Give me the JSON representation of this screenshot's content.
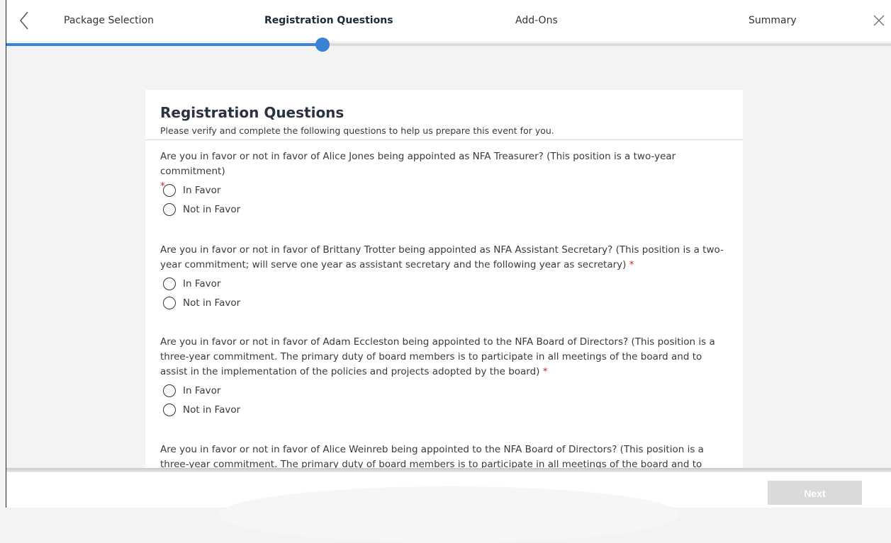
{
  "wizard": {
    "steps": [
      {
        "label": "Package Selection"
      },
      {
        "label": "Registration Questions"
      },
      {
        "label": "Add-Ons"
      },
      {
        "label": "Summary"
      }
    ],
    "active_step": 1,
    "progress": 0.36
  },
  "card": {
    "title": "Registration Questions",
    "subtitle": "Please verify and complete the following questions to help us prepare this event for you."
  },
  "questions": [
    {
      "text": "Are you in favor or not in favor of Alice Jones being appointed as NFA Treasurer? (This position is a two-year commitment)",
      "required_mark": "*",
      "options": [
        "In Favor",
        "Not in Favor"
      ]
    },
    {
      "text": "Are you in favor or not in favor of Brittany Trotter being appointed as NFA Assistant Secretary? (This position is a two-year commitment; will serve one year as assistant secretary and the following year as secretary)",
      "required_mark": "*",
      "options": [
        "In Favor",
        "Not in Favor"
      ]
    },
    {
      "text": "Are you in favor or not in favor of Adam Eccleston being appointed to the NFA Board of Directors? (This position is a three-year commitment. The primary duty of board members is to participate in all meetings of the board and to assist in the implementation of the policies and projects adopted by the board)",
      "required_mark": "*",
      "options": [
        "In Favor",
        "Not in Favor"
      ]
    },
    {
      "text": "Are you in favor or not in favor of Alice Weinreb being appointed to the NFA Board of Directors? (This position is a three-year commitment. The primary duty of board members is to participate in all meetings of the board and to assist in the",
      "required_mark": "",
      "options": []
    }
  ],
  "footer": {
    "next_label": "Next"
  },
  "colors": {
    "accent": "#3b82d6",
    "required": "#c0282d",
    "disabled_button": "#dadada"
  },
  "icons": {
    "back": "chevron-left-icon",
    "close": "close-icon"
  }
}
